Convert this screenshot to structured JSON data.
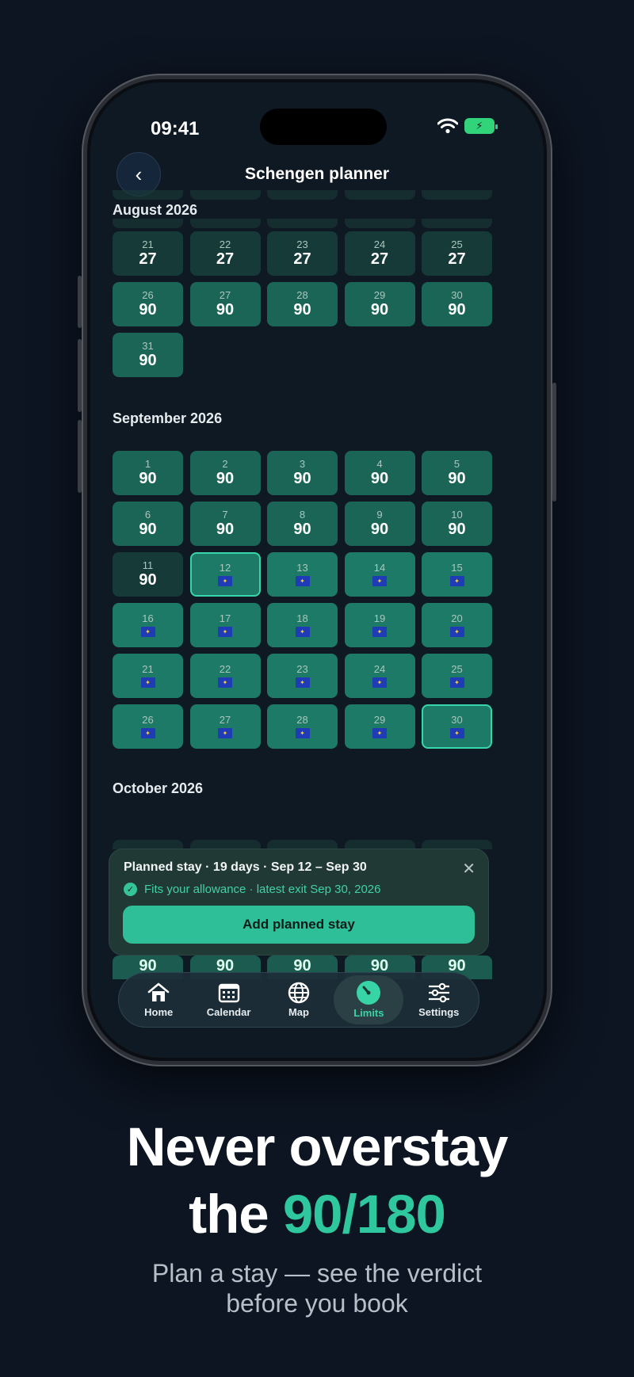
{
  "status_bar": {
    "time": "09:41"
  },
  "header": {
    "title": "Schengen planner",
    "back_icon": "chevron-left-icon"
  },
  "months": {
    "august": {
      "label": "August 2026",
      "days": [
        {
          "day": "21",
          "value": "27",
          "state": "dark"
        },
        {
          "day": "22",
          "value": "27",
          "state": "dark"
        },
        {
          "day": "23",
          "value": "27",
          "state": "dark"
        },
        {
          "day": "24",
          "value": "27",
          "state": "dark"
        },
        {
          "day": "25",
          "value": "27",
          "state": "dark"
        },
        {
          "day": "26",
          "value": "90",
          "state": "mid"
        },
        {
          "day": "27",
          "value": "90",
          "state": "mid"
        },
        {
          "day": "28",
          "value": "90",
          "state": "mid"
        },
        {
          "day": "29",
          "value": "90",
          "state": "mid"
        },
        {
          "day": "30",
          "value": "90",
          "state": "mid"
        },
        {
          "day": "31",
          "value": "90",
          "state": "mid"
        }
      ]
    },
    "september": {
      "label": "September 2026",
      "days": [
        {
          "day": "1",
          "value": "90",
          "state": "mid"
        },
        {
          "day": "2",
          "value": "90",
          "state": "mid"
        },
        {
          "day": "3",
          "value": "90",
          "state": "mid"
        },
        {
          "day": "4",
          "value": "90",
          "state": "mid"
        },
        {
          "day": "5",
          "value": "90",
          "state": "mid"
        },
        {
          "day": "6",
          "value": "90",
          "state": "mid"
        },
        {
          "day": "7",
          "value": "90",
          "state": "mid"
        },
        {
          "day": "8",
          "value": "90",
          "state": "mid"
        },
        {
          "day": "9",
          "value": "90",
          "state": "mid"
        },
        {
          "day": "10",
          "value": "90",
          "state": "mid"
        },
        {
          "day": "11",
          "value": "90",
          "state": "dark"
        },
        {
          "day": "12",
          "value": "",
          "state": "sel"
        },
        {
          "day": "13",
          "value": "",
          "state": "plan"
        },
        {
          "day": "14",
          "value": "",
          "state": "plan"
        },
        {
          "day": "15",
          "value": "",
          "state": "plan"
        },
        {
          "day": "16",
          "value": "",
          "state": "plan"
        },
        {
          "day": "17",
          "value": "",
          "state": "plan"
        },
        {
          "day": "18",
          "value": "",
          "state": "plan"
        },
        {
          "day": "19",
          "value": "",
          "state": "plan"
        },
        {
          "day": "20",
          "value": "",
          "state": "plan"
        },
        {
          "day": "21",
          "value": "",
          "state": "plan"
        },
        {
          "day": "22",
          "value": "",
          "state": "plan"
        },
        {
          "day": "23",
          "value": "",
          "state": "plan"
        },
        {
          "day": "24",
          "value": "",
          "state": "plan"
        },
        {
          "day": "25",
          "value": "",
          "state": "plan"
        },
        {
          "day": "26",
          "value": "",
          "state": "plan"
        },
        {
          "day": "27",
          "value": "",
          "state": "plan"
        },
        {
          "day": "28",
          "value": "",
          "state": "plan"
        },
        {
          "day": "29",
          "value": "",
          "state": "plan"
        },
        {
          "day": "30",
          "value": "",
          "state": "sel"
        }
      ]
    },
    "october": {
      "label": "October 2026",
      "partial_values": [
        "90",
        "90",
        "90",
        "90",
        "90"
      ]
    }
  },
  "panel": {
    "title": "Planned stay · 19 days · Sep 12 – Sep 30",
    "status": "Fits your allowance · latest exit Sep 30, 2026",
    "button": "Add planned stay",
    "close_icon": "close-icon",
    "check_icon": "check-circle-icon"
  },
  "tabs": [
    {
      "label": "Home",
      "icon": "home-icon"
    },
    {
      "label": "Calendar",
      "icon": "calendar-icon"
    },
    {
      "label": "Map",
      "icon": "globe-icon"
    },
    {
      "label": "Limits",
      "icon": "gauge-icon",
      "active": true
    },
    {
      "label": "Settings",
      "icon": "sliders-icon"
    }
  ],
  "marketing": {
    "headline_line1": "Never overstay",
    "headline_the": "the",
    "headline_accent": "90/180",
    "subline_1": "Plan a stay — see the verdict",
    "subline_2": "before you book"
  },
  "colors": {
    "accent": "#2fc79d",
    "background": "#0d1522"
  }
}
